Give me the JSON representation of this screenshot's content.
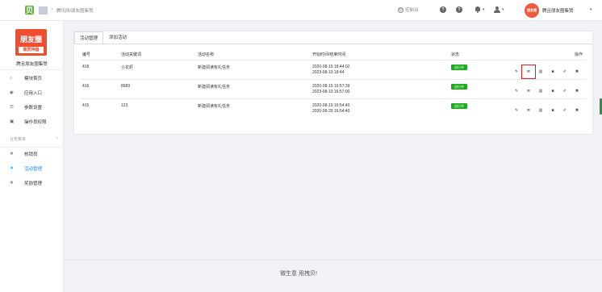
{
  "topbar": {
    "breadcrumb": "腾讯网/朋友圈集赞",
    "console_label": "控制台",
    "shop_name": "腾且朋友圈集赞",
    "avatar_text": "朋友圈"
  },
  "sidebar": {
    "brand_top": "朋友圈",
    "brand_bottom": "集赞神器",
    "brand_name": "腾且朋友圈集赞",
    "items": [
      {
        "label": "模块首页",
        "icon": "home-icon"
      },
      {
        "label": "应用入口",
        "icon": "entry-icon"
      },
      {
        "label": "参数设置",
        "icon": "settings-list-icon"
      },
      {
        "label": "操作员权限",
        "icon": "permission-icon"
      }
    ],
    "group_title": "业务菜单",
    "group_items": [
      {
        "label": "核销员",
        "icon": "gear-icon",
        "active": false
      },
      {
        "label": "活动管理",
        "icon": "gear-icon",
        "active": true
      },
      {
        "label": "奖励管理",
        "icon": "gear-icon",
        "active": false
      }
    ]
  },
  "tabs": [
    {
      "label": "活动管理",
      "active": true
    },
    {
      "label": "添加活动",
      "active": false
    }
  ],
  "table": {
    "headers": {
      "id": "编号",
      "keyword": "活动关键词",
      "name": "活动名称",
      "time": "开始时间/结束时间",
      "status": "状态",
      "actions": "操作"
    },
    "rows": [
      {
        "id": "418",
        "keyword": "小龙虾",
        "name": "新建阅读有礼任务",
        "start": "2020-08-19 18:44:02",
        "end": "2023-08-19 18:44",
        "status": "进行中"
      },
      {
        "id": "416",
        "keyword": "8989",
        "name": "新建阅读有礼任务",
        "start": "2020-08-19 16:57:39",
        "end": "2023-08-19 16:57:00",
        "status": "进行中"
      },
      {
        "id": "415",
        "keyword": "123",
        "name": "新建阅读有礼任务",
        "start": "2020-08-19 16:54:40",
        "end": "2020-08-29 16:54:40",
        "status": "进行中"
      }
    ],
    "action_icons": [
      "link-icon",
      "list-icon",
      "chart-icon",
      "stop-icon",
      "edit-icon",
      "delete-icon"
    ],
    "action_glyphs": [
      "✎",
      "≣",
      "▥",
      "■",
      "✐",
      "✖"
    ]
  },
  "footer": "微生意 用拽贝!",
  "colors": {
    "accent": "#1890ff",
    "status_green": "#1aad19",
    "brand_red": "#f04f2f",
    "highlight": "#e02020"
  }
}
